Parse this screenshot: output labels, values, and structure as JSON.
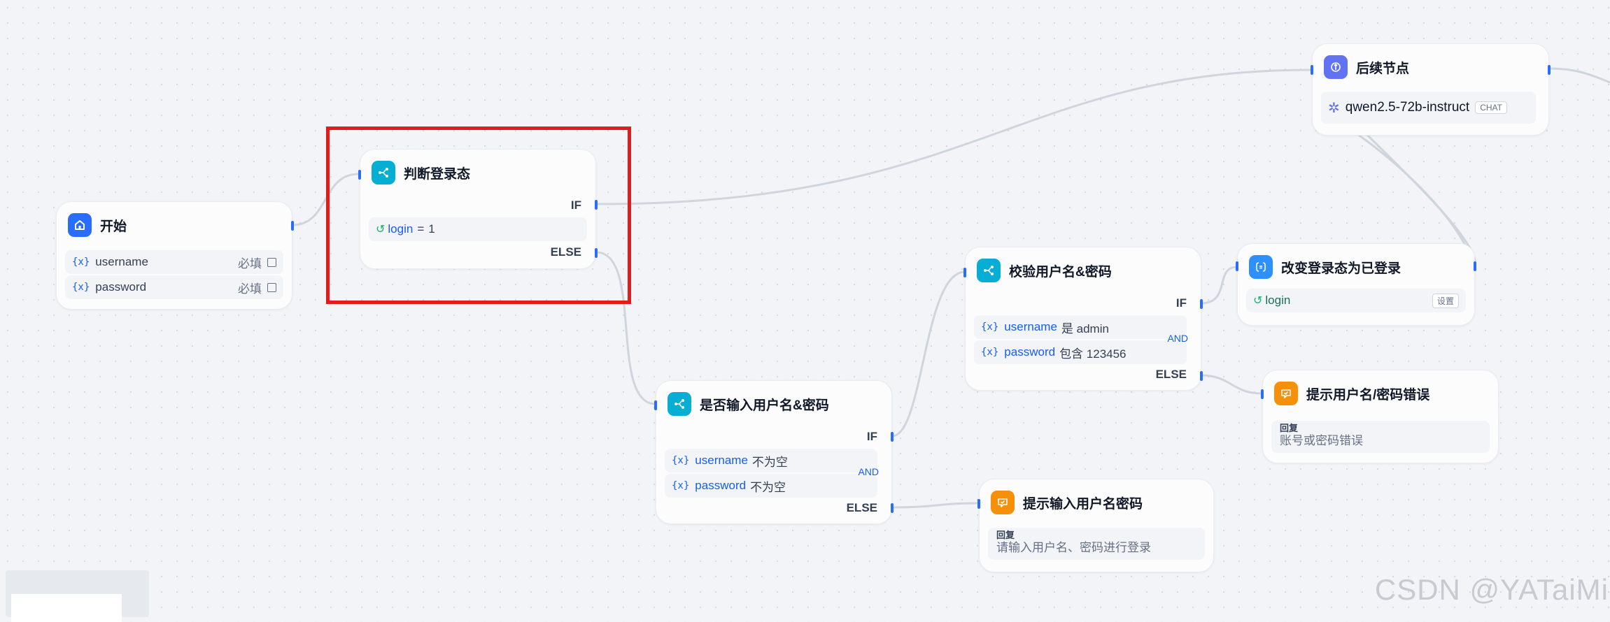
{
  "nodes": {
    "start": {
      "title": "开始",
      "inputs": [
        {
          "name": "username",
          "tag": "必填"
        },
        {
          "name": "password",
          "tag": "必填"
        }
      ]
    },
    "check_login": {
      "title": "判断登录态",
      "if_label": "IF",
      "else_label": "ELSE",
      "condition": {
        "var": "login",
        "op": "=",
        "value": "1"
      }
    },
    "check_input": {
      "title": "是否输入用户名&密码",
      "if_label": "IF",
      "else_label": "ELSE",
      "logic": "AND",
      "conditions": [
        {
          "var": "username",
          "op": "不为空"
        },
        {
          "var": "password",
          "op": "不为空"
        }
      ]
    },
    "verify": {
      "title": "校验用户名&密码",
      "if_label": "IF",
      "else_label": "ELSE",
      "logic": "AND",
      "conditions": [
        {
          "var": "username",
          "op": "是 admin"
        },
        {
          "var": "password",
          "op": "包含 123456"
        }
      ]
    },
    "set_login": {
      "title": "改变登录态为已登录",
      "var": "login",
      "action": "设置"
    },
    "followup": {
      "title": "后续节点",
      "model": "qwen2.5-72b-instruct",
      "model_tag": "CHAT"
    },
    "error_reply": {
      "title": "提示用户名/密码错误",
      "reply_label": "回复",
      "reply_text": "账号或密码错误"
    },
    "input_reply": {
      "title": "提示输入用户名密码",
      "reply_label": "回复",
      "reply_text": "请输入用户名、密码进行登录"
    }
  },
  "icons": {
    "var": "{x}"
  },
  "watermark": "CSDN @YATaiMi",
  "colors": {
    "accent": "#296dff",
    "highlight": "#e21c1c",
    "canvas": "#f2f4f7"
  }
}
